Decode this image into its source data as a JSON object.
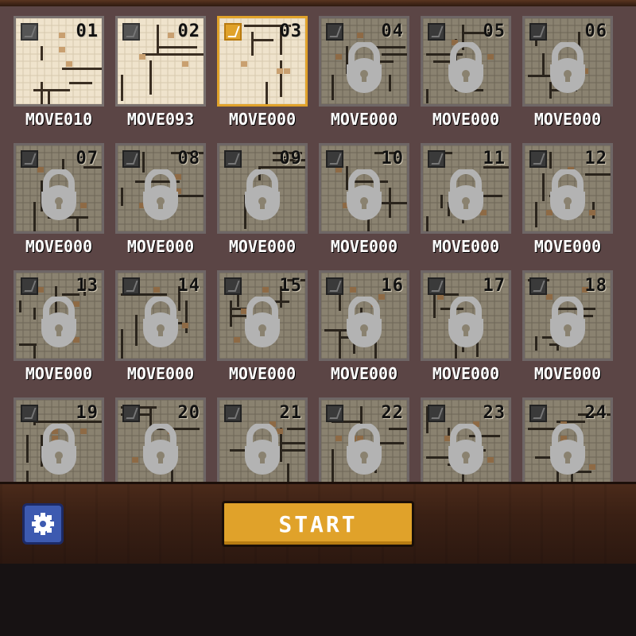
{
  "levels": [
    {
      "number": "01",
      "moves": "MOVE010",
      "state": "unlocked"
    },
    {
      "number": "02",
      "moves": "MOVE093",
      "state": "unlocked"
    },
    {
      "number": "03",
      "moves": "MOVE000",
      "state": "selected"
    },
    {
      "number": "04",
      "moves": "MOVE000",
      "state": "locked"
    },
    {
      "number": "05",
      "moves": "MOVE000",
      "state": "locked"
    },
    {
      "number": "06",
      "moves": "MOVE000",
      "state": "locked"
    },
    {
      "number": "07",
      "moves": "MOVE000",
      "state": "locked"
    },
    {
      "number": "08",
      "moves": "MOVE000",
      "state": "locked"
    },
    {
      "number": "09",
      "moves": "MOVE000",
      "state": "locked"
    },
    {
      "number": "10",
      "moves": "MOVE000",
      "state": "locked"
    },
    {
      "number": "11",
      "moves": "MOVE000",
      "state": "locked"
    },
    {
      "number": "12",
      "moves": "MOVE000",
      "state": "locked"
    },
    {
      "number": "13",
      "moves": "MOVE000",
      "state": "locked"
    },
    {
      "number": "14",
      "moves": "MOVE000",
      "state": "locked"
    },
    {
      "number": "15",
      "moves": "MOVE000",
      "state": "locked"
    },
    {
      "number": "16",
      "moves": "MOVE000",
      "state": "locked"
    },
    {
      "number": "17",
      "moves": "MOVE000",
      "state": "locked"
    },
    {
      "number": "18",
      "moves": "MOVE000",
      "state": "locked"
    },
    {
      "number": "19",
      "moves": "",
      "state": "locked"
    },
    {
      "number": "20",
      "moves": "",
      "state": "locked"
    },
    {
      "number": "21",
      "moves": "",
      "state": "locked"
    },
    {
      "number": "22",
      "moves": "",
      "state": "locked"
    },
    {
      "number": "23",
      "moves": "",
      "state": "locked"
    },
    {
      "number": "24",
      "moves": "",
      "state": "locked"
    }
  ],
  "footer": {
    "start_label": "START",
    "settings_icon": "gear-icon"
  },
  "colors": {
    "accent": "#e0a22a",
    "settings": "#3d5ab0",
    "panel": "#5b4545"
  }
}
